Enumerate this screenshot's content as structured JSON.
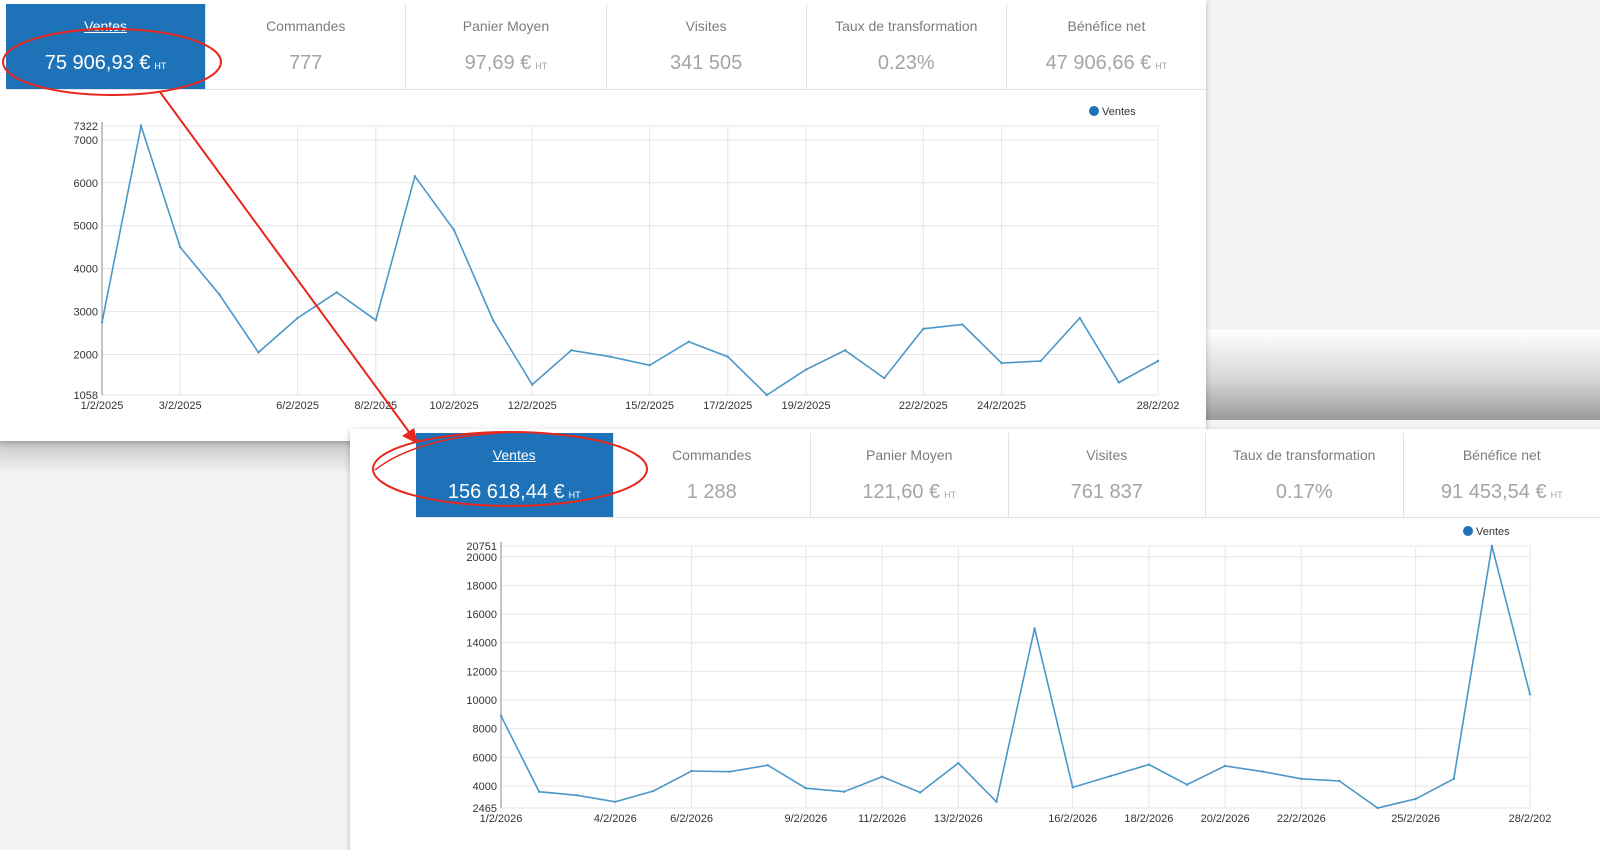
{
  "panels": [
    {
      "kpis": [
        {
          "label": "Ventes",
          "value": "75 906,93 €",
          "suffix": "HT",
          "active": true
        },
        {
          "label": "Commandes",
          "value": "777",
          "suffix": ""
        },
        {
          "label": "Panier Moyen",
          "value": "97,69 €",
          "suffix": "HT"
        },
        {
          "label": "Visites",
          "value": "341 505",
          "suffix": ""
        },
        {
          "label": "Taux de transformation",
          "value": "0.23%",
          "suffix": ""
        },
        {
          "label": "Bénéfice net",
          "value": "47 906,66 €",
          "suffix": "HT"
        }
      ]
    },
    {
      "kpis": [
        {
          "label": "Ventes",
          "value": "156 618,44 €",
          "suffix": "HT",
          "active": true
        },
        {
          "label": "Commandes",
          "value": "1 288",
          "suffix": ""
        },
        {
          "label": "Panier Moyen",
          "value": "121,60 €",
          "suffix": "HT"
        },
        {
          "label": "Visites",
          "value": "761 837",
          "suffix": ""
        },
        {
          "label": "Taux de transformation",
          "value": "0.17%",
          "suffix": ""
        },
        {
          "label": "Bénéfice net",
          "value": "91 453,54 €",
          "suffix": "HT"
        }
      ]
    }
  ],
  "colors": {
    "line": "#4a97c8",
    "accent": "#1e72b8",
    "annotation": "#e8261c",
    "grid": "#e6e6e6"
  },
  "chart_data": [
    {
      "type": "line",
      "legend": "Ventes",
      "legend_position": "top-right",
      "grid": true,
      "ylim": [
        1058,
        7322
      ],
      "yticks": [
        1058,
        2000,
        3000,
        4000,
        5000,
        6000,
        7000,
        7322
      ],
      "x": [
        "1/2/2025",
        "2/2/2025",
        "3/2/2025",
        "4/2/2025",
        "5/2/2025",
        "6/2/2025",
        "7/2/2025",
        "8/2/2025",
        "9/2/2025",
        "10/2/2025",
        "11/2/2025",
        "12/2/2025",
        "13/2/2025",
        "14/2/2025",
        "15/2/2025",
        "16/2/2025",
        "17/2/2025",
        "18/2/2025",
        "19/2/2025",
        "20/2/2025",
        "21/2/2025",
        "22/2/2025",
        "23/2/2025",
        "24/2/2025",
        "25/2/2025",
        "26/2/2025",
        "27/2/2025",
        "28/2/2025"
      ],
      "xtick_labels": [
        "1/2/2025",
        "3/2/2025",
        "6/2/2025",
        "8/2/2025",
        "10/2/2025",
        "12/2/2025",
        "15/2/2025",
        "17/2/2025",
        "19/2/2025",
        "22/2/2025",
        "24/2/2025",
        "28/2/202"
      ],
      "series": [
        {
          "name": "Ventes",
          "values": [
            2750,
            7322,
            4500,
            3400,
            2050,
            2850,
            3450,
            2800,
            6150,
            4900,
            2800,
            1300,
            2100,
            1950,
            1750,
            2300,
            1950,
            1058,
            1650,
            2100,
            1450,
            2600,
            2700,
            1800,
            1850,
            2850,
            1350,
            1850
          ]
        }
      ]
    },
    {
      "type": "line",
      "legend": "Ventes",
      "legend_position": "top-right",
      "grid": true,
      "ylim": [
        2465,
        20751
      ],
      "yticks": [
        2465,
        4000,
        6000,
        8000,
        10000,
        12000,
        14000,
        16000,
        18000,
        20000,
        20751
      ],
      "x": [
        "1/2/2026",
        "2/2/2026",
        "3/2/2026",
        "4/2/2026",
        "5/2/2026",
        "6/2/2026",
        "7/2/2026",
        "8/2/2026",
        "9/2/2026",
        "10/2/2026",
        "11/2/2026",
        "12/2/2026",
        "13/2/2026",
        "14/2/2026",
        "15/2/2026",
        "16/2/2026",
        "17/2/2026",
        "18/2/2026",
        "19/2/2026",
        "20/2/2026",
        "21/2/2026",
        "22/2/2026",
        "23/2/2026",
        "24/2/2026",
        "25/2/2026",
        "26/2/2026",
        "27/2/2026",
        "28/2/2026"
      ],
      "xtick_labels": [
        "1/2/2026",
        "4/2/2026",
        "6/2/2026",
        "9/2/2026",
        "11/2/2026",
        "13/2/2026",
        "16/2/2026",
        "18/2/2026",
        "20/2/2026",
        "22/2/2026",
        "25/2/2026",
        "28/2/202"
      ],
      "series": [
        {
          "name": "Ventes",
          "values": [
            8900,
            3600,
            3350,
            2900,
            3650,
            5050,
            5000,
            5450,
            3850,
            3600,
            4650,
            3550,
            5600,
            2900,
            15000,
            3900,
            4700,
            5500,
            4100,
            5400,
            5000,
            4500,
            4350,
            2465,
            3100,
            4500,
            20751,
            10400
          ]
        }
      ]
    }
  ]
}
